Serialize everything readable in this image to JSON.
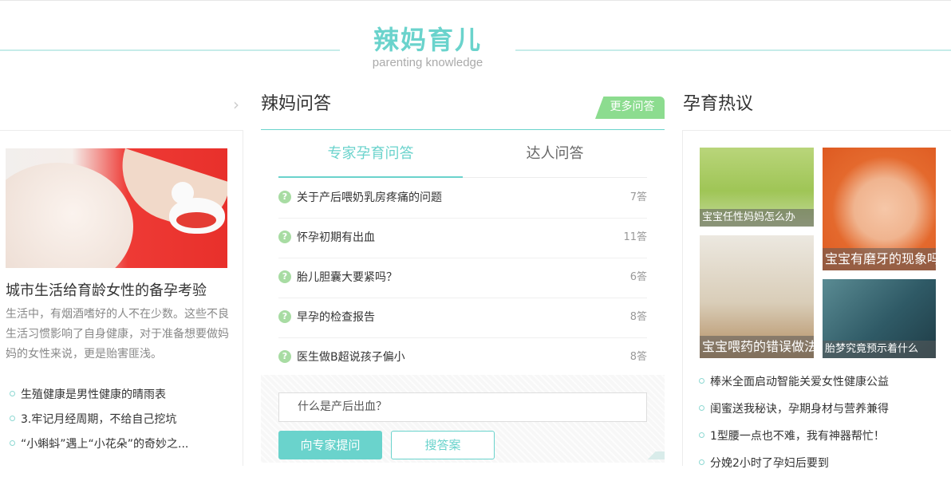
{
  "banner": {
    "title": "辣妈育儿",
    "subtitle": "parenting knowledge"
  },
  "left": {
    "article_title": "城市生活给育龄女性的备孕考验",
    "article_desc": "生活中，有烟酒嗜好的人不在少数。这些不良生活习惯影响了自身健康，对于准备想要做妈妈的女性来说，更是贻害匪浅。",
    "list": [
      "生殖健康是男性健康的晴雨表",
      "3.牢记月经周期，不给自己挖坑",
      "“小蝌蚪”遇上“小花朵”的奇妙之..."
    ]
  },
  "middle": {
    "title": "辣妈问答",
    "more_label": "更多问答",
    "tabs": [
      "专家孕育问答",
      "达人问答"
    ],
    "qmark": "?",
    "questions": [
      {
        "text": "关于产后喂奶乳房疼痛的问题",
        "count": "7答"
      },
      {
        "text": "怀孕初期有出血",
        "count": "11答"
      },
      {
        "text": "胎儿胆囊大要紧吗？",
        "count": "6答"
      },
      {
        "text": "早孕的检查报告",
        "count": "8答"
      },
      {
        "text": "医生做B超说孩子偏小",
        "count": "8答"
      }
    ],
    "ask_placeholder": "什么是产后出血？",
    "ask_button": "向专家提问",
    "search_button": "搜答案"
  },
  "right": {
    "title": "孕育热议",
    "photos": [
      "宝宝任性妈妈怎么办",
      "宝宝有磨牙的现象吗",
      "宝宝喂药的错误做法",
      "胎梦究竟预示着什么"
    ],
    "list": [
      "棒米全面启动智能关爱女性健康公益",
      "闺蜜送我秘诀，孕期身材与营养兼得",
      "1型腰一点也不难，我有神器帮忙！",
      "分娩2小时了孕妇后要到"
    ]
  }
}
